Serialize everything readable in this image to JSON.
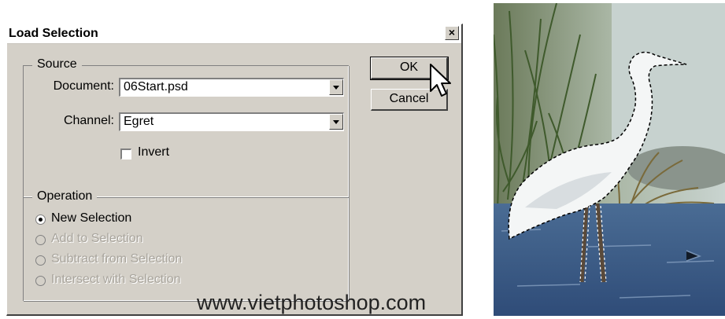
{
  "dialog": {
    "title": "Load Selection",
    "close_glyph": "×",
    "source": {
      "legend": "Source",
      "document_label": "Document:",
      "document_value": "06Start.psd",
      "channel_label": "Channel:",
      "channel_value": "Egret",
      "invert_label": "Invert",
      "invert_checked": false
    },
    "operation": {
      "legend": "Operation",
      "options": [
        {
          "label": "New Selection",
          "checked": true,
          "enabled": true
        },
        {
          "label": "Add to Selection",
          "checked": false,
          "enabled": false
        },
        {
          "label": "Subtract from Selection",
          "checked": false,
          "enabled": false
        },
        {
          "label": "Intersect with Selection",
          "checked": false,
          "enabled": false
        }
      ]
    },
    "buttons": {
      "ok": "OK",
      "cancel": "Cancel"
    }
  },
  "watermark": "www.vietphotoshop.com",
  "icons": {
    "cursor": "arrow-cursor-icon",
    "select_arrow": "chevron-down-icon",
    "close": "close-icon"
  }
}
